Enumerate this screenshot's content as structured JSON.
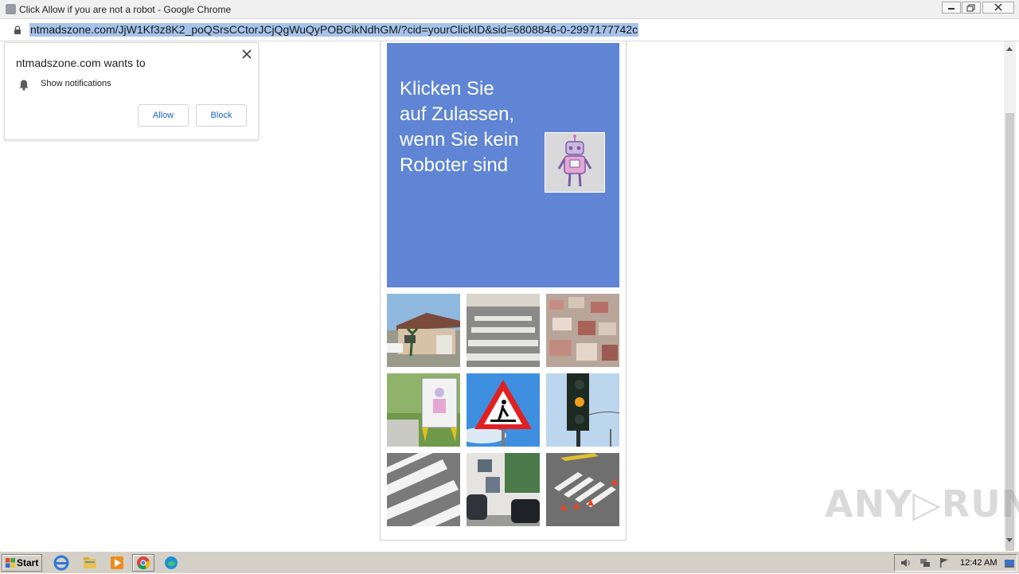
{
  "window": {
    "title": "Click Allow if you are not a robot - Google Chrome",
    "minimize_label": "▭",
    "restore_label": "❐",
    "close_label": "✕"
  },
  "address_bar": {
    "url": "ntmadszone.com/JjW1Kf3z8K2_poQSrsCCtorJCjQgWuQyPOBCikNdhGM/?cid=yourClickID&sid=6808846-0-2997177742c"
  },
  "notification_popup": {
    "title": "ntmadszone.com wants to",
    "permission": "Show notifications",
    "allow_label": "Allow",
    "block_label": "Block"
  },
  "page": {
    "banner_text": "Klicken Sie auf Zulassen, wenn Sie kein Roboter sind",
    "banner_color": "#5f85d4",
    "tiles": [
      "house",
      "crosswalk",
      "suburb",
      "robot-sign",
      "pedestrian-sign",
      "traffic-light",
      "zebra-stripes",
      "street-cars",
      "crossing-cones"
    ]
  },
  "watermark": "ANY▷RUN",
  "taskbar": {
    "start_label": "Start",
    "clock": "12:42 AM",
    "pinned_icons": [
      "internet-explorer-icon",
      "explorer-icon",
      "media-player-icon",
      "chrome-icon",
      "edge-icon"
    ]
  }
}
